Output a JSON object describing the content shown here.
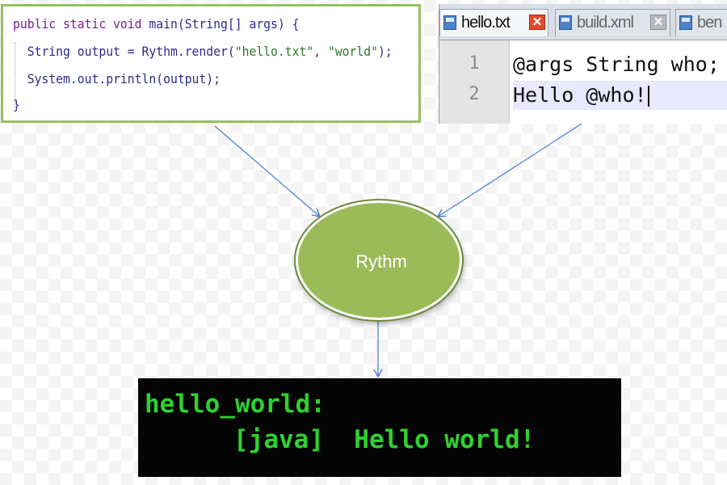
{
  "java_code": {
    "line1": {
      "kw": "public static void",
      "rest": " main(String[] args) {"
    },
    "line2": {
      "pre": "  String output = Rythm.render(",
      "s1": "\"hello.txt\"",
      "mid": ", ",
      "s2": "\"world\"",
      "post": ");"
    },
    "line3": "  System.out.println(output);",
    "line4": "}"
  },
  "editor": {
    "tabs": [
      {
        "label": "hello.txt",
        "active": true
      },
      {
        "label": "build.xml",
        "active": false
      },
      {
        "label": "ben",
        "active": false
      }
    ],
    "lines": [
      {
        "number": "1",
        "text": "@args String who;"
      },
      {
        "number": "2",
        "text": "Hello @who!"
      }
    ]
  },
  "node": {
    "label": "Rythm"
  },
  "console": {
    "line1": "hello_world:",
    "line2": "[java]  Hello world!"
  },
  "colors": {
    "code_border": "#97bf63",
    "node_fill": "#9bbb59",
    "console_text": "#2fd12f",
    "arrow": "#4a7bd0"
  }
}
